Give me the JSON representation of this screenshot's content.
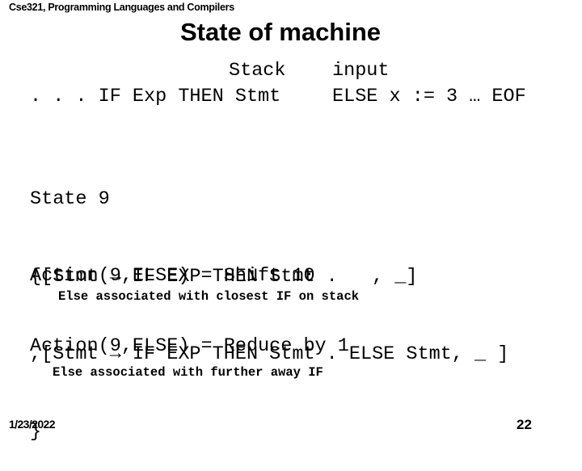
{
  "header": {
    "course": "Cse321, Programming Languages and Compilers"
  },
  "slide": {
    "title": "State of machine",
    "stack_label": "Stack",
    "input_label": "input",
    "stack_content": ". . . IF Exp THEN Stmt",
    "input_content": "ELSE x := 3 … EOF",
    "state": {
      "name": "State 9",
      "items": [
        "{[Stmt → IF EXP THEN Stmt .   , _]",
        ",[Stmt → IF EXP THEN Stmt . ELSE Stmt, _ ]",
        "}"
      ]
    },
    "actions": [
      {
        "rule": "Action(9,ELSE) = Shift 10",
        "note": "Else associated with closest IF on stack"
      },
      {
        "rule": "Action(9,ELSE) = Reduce by 1",
        "note": "Else associated with further away IF"
      }
    ]
  },
  "footer": {
    "date": "1/23/2022",
    "page_number": "22"
  }
}
